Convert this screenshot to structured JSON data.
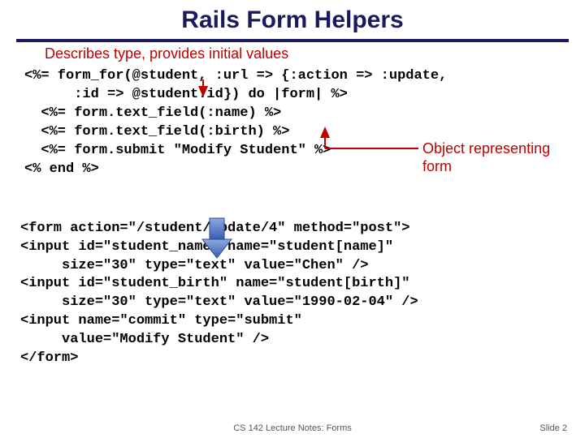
{
  "title": "Rails Form Helpers",
  "subtitle": "Describes type, provides initial values",
  "note": {
    "line1": "Object representing",
    "line2": "form"
  },
  "code_top": "<%= form_for(@student, :url => {:action => :update,\n      :id => @student.id}) do |form| %>\n  <%= form.text_field(:name) %>\n  <%= form.text_field(:birth) %>\n  <%= form.submit \"Modify Student\" %>\n<% end %>",
  "code_bottom": "<form action=\"/student/update/4\" method=\"post\">\n<input id=\"student_name\" name=\"student[name]\"\n     size=\"30\" type=\"text\" value=\"Chen\" />\n<input id=\"student_birth\" name=\"student[birth]\"\n     size=\"30\" type=\"text\" value=\"1990-02-04\" />\n<input name=\"commit\" type=\"submit\"\n     value=\"Modify Student\" />\n</form>",
  "footer": "CS 142 Lecture Notes: Forms",
  "slide": "Slide 2"
}
